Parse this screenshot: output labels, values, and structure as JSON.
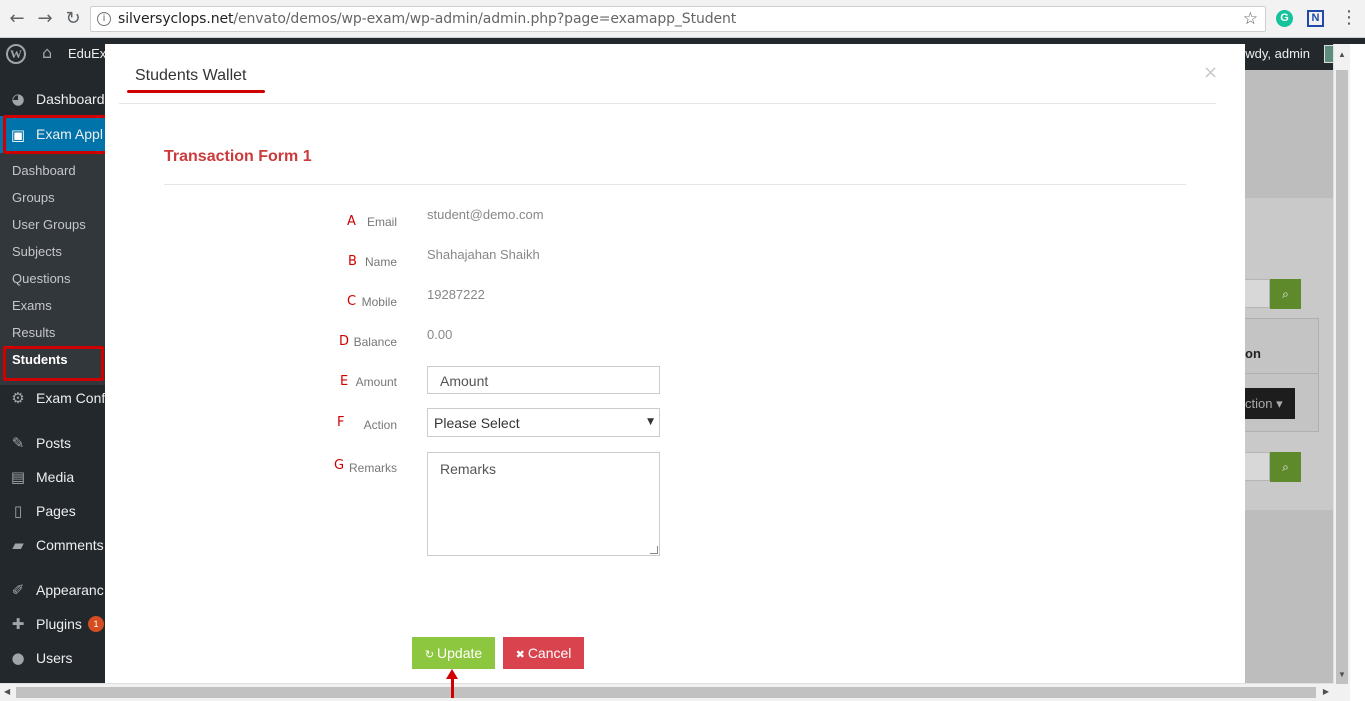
{
  "browser": {
    "url_host": "silversyclops.net",
    "url_path": "/envato/demos/wp-exam/wp-admin/admin.php?page=examapp_Student"
  },
  "adminbar": {
    "site_name": "EduEx",
    "howdy": "owdy, admin"
  },
  "sidebar": {
    "dashboard": "Dashboard",
    "exam_app": "Exam Appl",
    "submenu": [
      "Dashboard",
      "Groups",
      "User Groups",
      "Subjects",
      "Questions",
      "Exams",
      "Results",
      "Students"
    ],
    "exam_config": "Exam Conf",
    "posts": "Posts",
    "media": "Media",
    "pages": "Pages",
    "comments": "Comments",
    "appearance": "Appearanc",
    "plugins": "Plugins",
    "plugins_badge": "1",
    "users": "Users"
  },
  "background": {
    "column_header": "on",
    "action_button": "ction ▾"
  },
  "modal": {
    "title": "Students Wallet",
    "close": "×",
    "form_title": "Transaction Form 1",
    "fields": [
      {
        "letter": "A",
        "label": "Email",
        "value": "student@demo.com"
      },
      {
        "letter": "B",
        "label": "Name",
        "value": "Shahajahan Shaikh"
      },
      {
        "letter": "C",
        "label": "Mobile",
        "value": "19287222"
      },
      {
        "letter": "D",
        "label": "Balance",
        "value": "0.00"
      },
      {
        "letter": "E",
        "label": "Amount",
        "placeholder": "Amount"
      },
      {
        "letter": "F",
        "label": "Action",
        "selected": "Please Select"
      },
      {
        "letter": "G",
        "label": "Remarks",
        "placeholder": "Remarks"
      }
    ],
    "update_label": "Update",
    "cancel_label": "Cancel"
  },
  "colors": {
    "accent_red": "#d10000",
    "update_green": "#8dc63f",
    "cancel_red": "#d9434e",
    "wp_blue": "#0073aa"
  }
}
